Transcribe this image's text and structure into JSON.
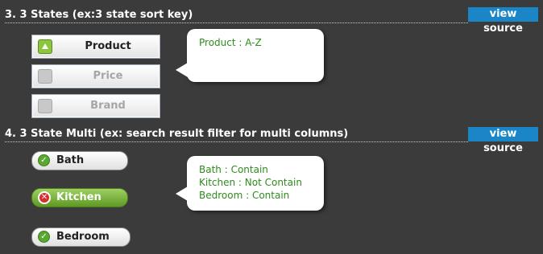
{
  "sections": [
    {
      "title": "3. 3 States (ex:3 state sort key)",
      "view_source": "view source"
    },
    {
      "title": "4. 3 State Multi (ex: search result filter for multi columns)",
      "view_source": "view source"
    }
  ],
  "sort": {
    "buttons": [
      {
        "label": "Product",
        "state": "ascending"
      },
      {
        "label": "Price",
        "state": "off"
      },
      {
        "label": "Brand",
        "state": "off"
      }
    ],
    "bubble": [
      "Product : A-Z"
    ]
  },
  "filter": {
    "toggles": [
      {
        "label": "Bath",
        "state": "contain"
      },
      {
        "label": "Kitchen",
        "state": "not contain"
      },
      {
        "label": "Bedroom",
        "state": "contain"
      }
    ],
    "bubble": [
      "Bath : Contain",
      "Kitchen : Not Contain",
      "Bedroom : Contain"
    ]
  },
  "colors": {
    "background": "#3b3b3b",
    "view_source_button": "#1a86c7",
    "bubble_text": "#2e8b1e",
    "active_green": "#8cc63f",
    "not_contain_red": "#d72e2e"
  }
}
